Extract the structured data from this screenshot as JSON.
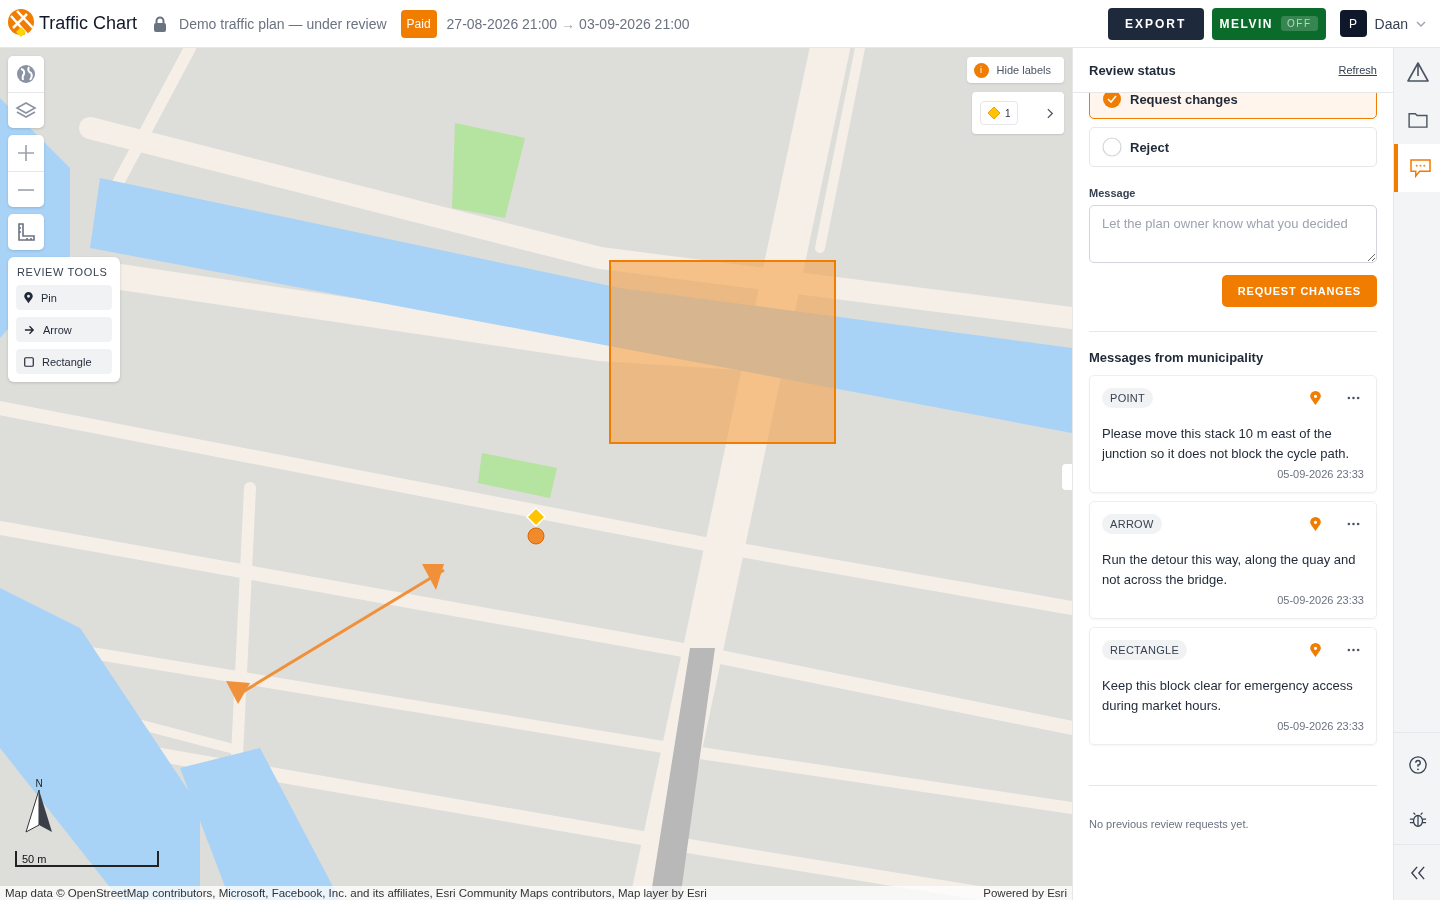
{
  "header": {
    "app_name": "Traffic Chart",
    "locked": true,
    "plan_title": "Demo traffic plan — under review",
    "status_badge": "Paid",
    "date_from": "27-08-2026 21:00",
    "date_arrow": "→",
    "date_to": "03-09-2026 21:00",
    "export_button": "EXPORT",
    "melvin": {
      "label": "MELVIN",
      "state": "OFF",
      "on": false
    },
    "user": {
      "initial": "P",
      "name": "Daan"
    }
  },
  "map": {
    "hide_labels_button": "Hide labels",
    "hide_labels_badge": "i",
    "layer_count": "1",
    "review_tools": {
      "title": "REVIEW TOOLS",
      "tools": [
        {
          "kind": "pin",
          "label": "Pin"
        },
        {
          "kind": "arrow",
          "label": "Arrow"
        },
        {
          "kind": "rectangle",
          "label": "Rectangle"
        }
      ]
    },
    "annotations": [
      {
        "kind": "rectangle"
      },
      {
        "kind": "arrow"
      },
      {
        "kind": "pin"
      }
    ],
    "north": "N",
    "scale": "50 m",
    "attribution": "Map data © OpenStreetMap contributors, Microsoft, Facebook, Inc. and its affiliates, Esri Community Maps contributors, Map layer by Esri",
    "powered_by": "Powered by Esri"
  },
  "review_status": {
    "title": "Review status",
    "refresh": "Refresh",
    "options": [
      {
        "label": "Request changes",
        "selected": true
      },
      {
        "label": "Reject",
        "selected": false
      }
    ],
    "message_label": "Message",
    "message_placeholder": "Let the plan owner know what you decided",
    "submit_button": "REQUEST CHANGES"
  },
  "messages": {
    "title": "Messages from municipality",
    "items": [
      {
        "type_label": "POINT",
        "text": "Please move this stack 10 m east of the junction so it does not block the cycle path.",
        "time": "05-09-2026 23:33"
      },
      {
        "type_label": "ARROW",
        "text": "Run the detour this way, along the quay and not across the bridge.",
        "time": "05-09-2026 23:33"
      },
      {
        "type_label": "RECTANGLE",
        "text": "Keep this block clear for emergency access during market hours.",
        "time": "05-09-2026 23:33"
      }
    ]
  },
  "history_note": "No previous review requests yet.",
  "rail": {
    "items": [
      {
        "kind": "warning",
        "selected": false
      },
      {
        "kind": "folder",
        "selected": false
      },
      {
        "kind": "comments",
        "selected": true
      }
    ],
    "bottom": [
      {
        "kind": "help"
      },
      {
        "kind": "bug"
      },
      {
        "kind": "collapse"
      }
    ]
  }
}
